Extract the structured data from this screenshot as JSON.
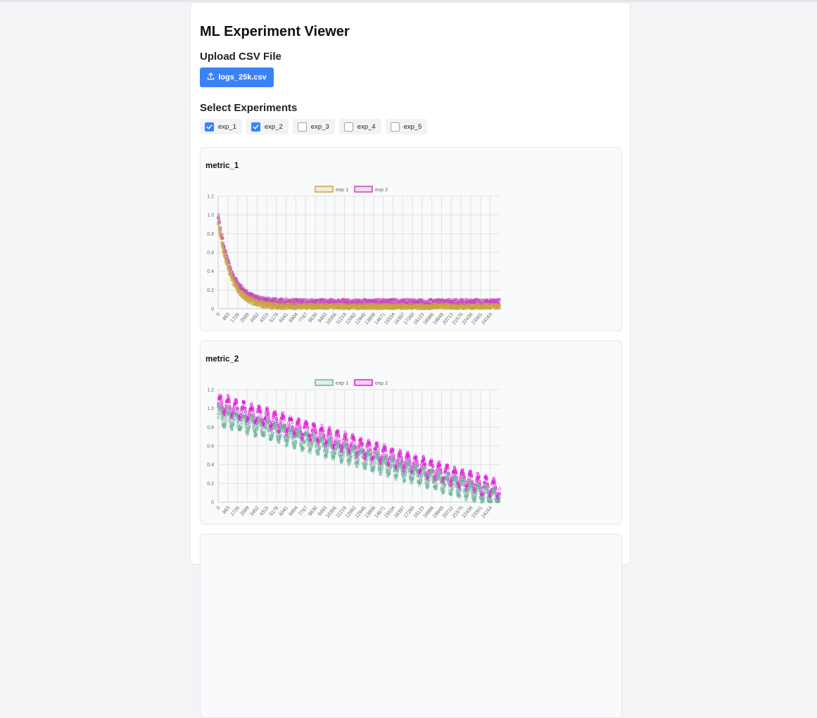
{
  "app": {
    "title": "ML Experiment Viewer"
  },
  "upload": {
    "heading": "Upload CSV File",
    "file_name": "logs_25k.csv"
  },
  "experiments": {
    "heading": "Select Experiments",
    "items": [
      {
        "label": "exp_1",
        "checked": true
      },
      {
        "label": "exp_2",
        "checked": true
      },
      {
        "label": "exp_3",
        "checked": false
      },
      {
        "label": "exp_4",
        "checked": false
      },
      {
        "label": "exp_5",
        "checked": false
      }
    ]
  },
  "panels": [
    {
      "title": "metric_1"
    },
    {
      "title": "metric_2"
    }
  ],
  "chart_data": [
    {
      "type": "scatter",
      "title": "metric_1",
      "ylim": [
        0,
        1.2
      ],
      "yticks": [
        "1.2",
        "1.0",
        "0.8",
        "0.6",
        "0.4",
        "0.2",
        "0"
      ],
      "xticks": [
        "0",
        "863",
        "1726",
        "2589",
        "3452",
        "4315",
        "5178",
        "6041",
        "6904",
        "7767",
        "8630",
        "9493",
        "10356",
        "11219",
        "12082",
        "12945",
        "13808",
        "14671",
        "15534",
        "16397",
        "17260",
        "18123",
        "18986",
        "19849",
        "20712",
        "21575",
        "22438",
        "23301",
        "24164"
      ],
      "xlim": [
        0,
        25000
      ],
      "grid": true,
      "legend_position": "top",
      "series": [
        {
          "name": "exp_1",
          "color": "#c9a53f",
          "shape": "exponential decay 0.95 → ~0.03 (k≈0.0009), noisy band",
          "start": 0.95,
          "end": 0.02
        },
        {
          "name": "exp_2",
          "color": "#c548b8",
          "shape": "exponential decay 1.0 → ~0.05 (k≈0.0009), noisy band",
          "start": 1.0,
          "end": 0.05
        }
      ]
    },
    {
      "type": "scatter",
      "title": "metric_2",
      "ylim": [
        0,
        1.2
      ],
      "yticks": [
        "1.2",
        "1.0",
        "0.8",
        "0.6",
        "0.4",
        "0.2",
        "0"
      ],
      "xticks": [
        "0",
        "863",
        "1726",
        "2589",
        "3452",
        "4315",
        "5178",
        "6041",
        "6904",
        "7767",
        "8630",
        "9493",
        "10356",
        "11219",
        "12082",
        "12945",
        "13808",
        "14671",
        "15534",
        "16397",
        "17260",
        "18123",
        "18986",
        "19849",
        "20712",
        "21575",
        "22438",
        "23301",
        "24164"
      ],
      "xlim": [
        0,
        25000
      ],
      "grid": true,
      "legend_position": "top",
      "series": [
        {
          "name": "exp_1",
          "color": "#6db39a",
          "shape": "linear decline 0.95 → 0.05 with periodic oscillation",
          "start": 0.95,
          "end": 0.05,
          "oscillations": 36
        },
        {
          "name": "exp_2",
          "color": "#e01ad8",
          "shape": "linear decline 1.05 → 0.12 with periodic oscillation",
          "start": 1.05,
          "end": 0.12,
          "oscillations": 36
        }
      ]
    }
  ]
}
